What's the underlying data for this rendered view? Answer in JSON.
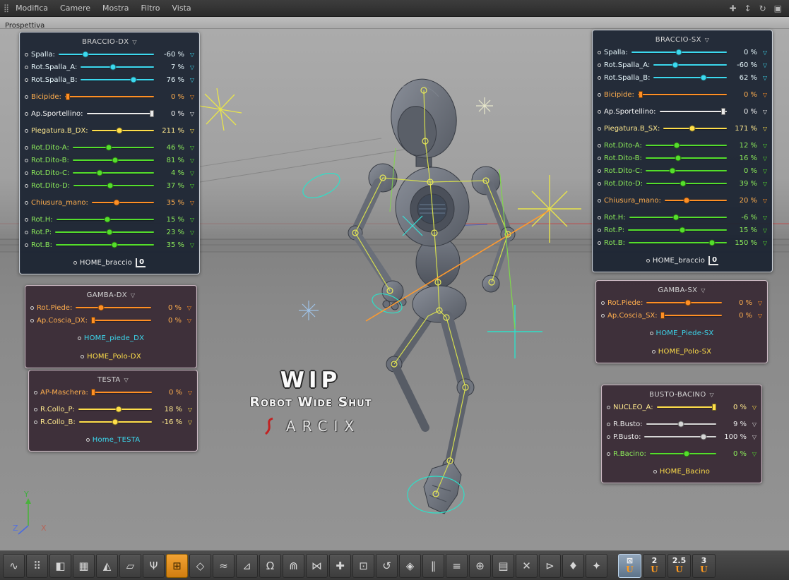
{
  "menubar": {
    "grid_icon": "⣿",
    "items": [
      "Modifica",
      "Camere",
      "Mostra",
      "Filtro",
      "Vista"
    ],
    "right_icons": [
      {
        "name": "pan-view-icon",
        "glyph": "✚"
      },
      {
        "name": "zoom-view-icon",
        "glyph": "↕"
      },
      {
        "name": "rotate-view-icon",
        "glyph": "↻"
      },
      {
        "name": "maximize-view-icon",
        "glyph": "▣"
      }
    ]
  },
  "viewport": {
    "label": "Prospettiva",
    "watermark": {
      "title": "WIP",
      "subtitle": "Robot Wide Shut",
      "brand": "ARCIX"
    },
    "axis": {
      "x": "X",
      "y": "Y",
      "z": "Z"
    }
  },
  "glyphs": {
    "collapse": "▽",
    "envelope": "▽"
  },
  "panels": [
    {
      "id": "braccio-dx",
      "title": "BRACCIO-DX",
      "rows": [
        {
          "label": "Spalla:",
          "value": "-60 %",
          "color": "cyan",
          "pos": 0.28
        },
        {
          "label": "Rot.Spalla_A:",
          "value": "7 %",
          "color": "cyan",
          "pos": 0.44
        },
        {
          "label": "Rot.Spalla_B:",
          "value": "76 %",
          "color": "cyan",
          "pos": 0.72
        },
        {
          "label": "Bicipide:",
          "value": "0 %",
          "color": "orange",
          "pos": 0.03,
          "knob": "square",
          "gap": true
        },
        {
          "label": "Ap.Sportellino:",
          "value": "0 %",
          "color": "white",
          "pos": 0.97,
          "knob": "square",
          "gap": true
        },
        {
          "label": "Piegatura.B_DX:",
          "value": "211 %",
          "color": "yellow",
          "pos": 0.44,
          "gap": true
        },
        {
          "label": "Rot.Dito-A:",
          "value": "46 %",
          "color": "green",
          "pos": 0.44,
          "gap": true
        },
        {
          "label": "Rot.Dito-B:",
          "value": "81 %",
          "color": "green",
          "pos": 0.52
        },
        {
          "label": "Rot.Dito-C:",
          "value": "4 %",
          "color": "green",
          "pos": 0.33
        },
        {
          "label": "Rot.Dito-D:",
          "value": "37 %",
          "color": "green",
          "pos": 0.46
        },
        {
          "label": "Chiusura_mano:",
          "value": "35 %",
          "color": "orange",
          "pos": 0.4,
          "gap": true
        },
        {
          "label": "Rot.H:",
          "value": "15 %",
          "color": "green",
          "pos": 0.52,
          "gap": true
        },
        {
          "label": "Rot.P:",
          "value": "23 %",
          "color": "green",
          "pos": 0.55
        },
        {
          "label": "Rot.B:",
          "value": "35 %",
          "color": "green",
          "pos": 0.6
        }
      ],
      "home": [
        {
          "label": "HOME_braccio",
          "color": "white",
          "badge": "0"
        }
      ]
    },
    {
      "id": "braccio-sx",
      "title": "BRACCIO-SX",
      "rows": [
        {
          "label": "Spalla:",
          "value": "0 %",
          "color": "cyan",
          "pos": 0.5
        },
        {
          "label": "Rot.Spalla_A:",
          "value": "-60 %",
          "color": "cyan",
          "pos": 0.3
        },
        {
          "label": "Rot.Spalla_B:",
          "value": "62 %",
          "color": "cyan",
          "pos": 0.68
        },
        {
          "label": "Bicipide:",
          "value": "0 %",
          "color": "orange",
          "pos": 0.03,
          "knob": "square",
          "gap": true
        },
        {
          "label": "Ap.Sportellino:",
          "value": "0 %",
          "color": "white",
          "pos": 0.95,
          "knob": "square",
          "gap": true
        },
        {
          "label": "Piegatura.B_SX:",
          "value": "171 %",
          "color": "yellow",
          "pos": 0.45,
          "gap": true
        },
        {
          "label": "Rot.Dito-A:",
          "value": "12 %",
          "color": "green",
          "pos": 0.38,
          "gap": true
        },
        {
          "label": "Rot.Dito-B:",
          "value": "16 %",
          "color": "green",
          "pos": 0.4
        },
        {
          "label": "Rot.Dito-C:",
          "value": "0 %",
          "color": "green",
          "pos": 0.33
        },
        {
          "label": "Rot.Dito-D:",
          "value": "39 %",
          "color": "green",
          "pos": 0.46
        },
        {
          "label": "Chiusura_mano:",
          "value": "20 %",
          "color": "orange",
          "pos": 0.35,
          "gap": true
        },
        {
          "label": "Rot.H:",
          "value": "-6 %",
          "color": "green",
          "pos": 0.48,
          "gap": true
        },
        {
          "label": "Rot.P:",
          "value": "15 %",
          "color": "green",
          "pos": 0.55
        },
        {
          "label": "Rot.B:",
          "value": "150 %",
          "color": "green",
          "pos": 0.85
        }
      ],
      "home": [
        {
          "label": "HOME_braccio",
          "color": "white",
          "badge": "0"
        }
      ]
    },
    {
      "id": "gamba-dx",
      "title": "GAMBA-DX",
      "rows": [
        {
          "label": "Rot.Piede:",
          "value": "0 %",
          "color": "orange",
          "pos": 0.33
        },
        {
          "label": "Ap.Coscia_DX:",
          "value": "0 %",
          "color": "orange",
          "pos": 0.03,
          "knob": "square"
        }
      ],
      "home": [
        {
          "label": "HOME_piede_DX",
          "color": "cyan"
        },
        {
          "label": "HOME_Polo-DX",
          "color": "yellow"
        }
      ]
    },
    {
      "id": "gamba-sx",
      "title": "GAMBA-SX",
      "rows": [
        {
          "label": "Rot.Piede:",
          "value": "0 %",
          "color": "orange",
          "pos": 0.55
        },
        {
          "label": "Ap.Coscia_SX:",
          "value": "0 %",
          "color": "orange",
          "pos": 0.03,
          "knob": "square"
        }
      ],
      "home": [
        {
          "label": "HOME_Piede-SX",
          "color": "cyan"
        },
        {
          "label": "HOME_Polo-SX",
          "color": "yellow"
        }
      ]
    },
    {
      "id": "testa",
      "title": "TESTA",
      "rows": [
        {
          "label": "AP-Maschera:",
          "value": "0 %",
          "color": "orange",
          "pos": 0.03,
          "knob": "square"
        },
        {
          "label": "R.Collo_P:",
          "value": "18 %",
          "color": "yellow",
          "pos": 0.55,
          "gap": true
        },
        {
          "label": "R.Collo_B:",
          "value": "-16 %",
          "color": "yellow",
          "pos": 0.5
        }
      ],
      "home": [
        {
          "label": "Home_TESTA",
          "color": "cyan"
        }
      ]
    },
    {
      "id": "busto-bacino",
      "title": "BUSTO-BACINO",
      "rows": [
        {
          "label": "NUCLEO_A:",
          "value": "0 %",
          "color": "yellow",
          "pos": 0.96,
          "knob": "square"
        },
        {
          "label": "R.Busto:",
          "value": "9 %",
          "color": "gray",
          "pos": 0.5,
          "gap": true
        },
        {
          "label": "P.Busto:",
          "value": "100 %",
          "color": "gray",
          "pos": 0.82
        },
        {
          "label": "R.Bacino:",
          "value": "0 %",
          "color": "green",
          "pos": 0.55,
          "gap": true
        }
      ],
      "home": [
        {
          "label": "HOME_Bacino",
          "color": "yellow"
        }
      ]
    }
  ],
  "toolbar": {
    "tools": [
      "∿",
      "⠿",
      "◧",
      "▦",
      "◭",
      "▱",
      "Ψ",
      "⊞",
      "◇",
      "≈",
      "⊿",
      "Ω",
      "⋒",
      "⋈",
      "✚",
      "⊡",
      "↺",
      "◈",
      "∥",
      "≡",
      "⊕",
      "▤",
      "✕",
      "⊳",
      "♦",
      "✦"
    ],
    "active_index": 7,
    "view_buttons": [
      {
        "label": "⊠",
        "sub": "U",
        "active": true
      },
      {
        "label": "2",
        "sub": "U"
      },
      {
        "label": "2.5",
        "sub": "U"
      },
      {
        "label": "3",
        "sub": "U"
      }
    ]
  }
}
